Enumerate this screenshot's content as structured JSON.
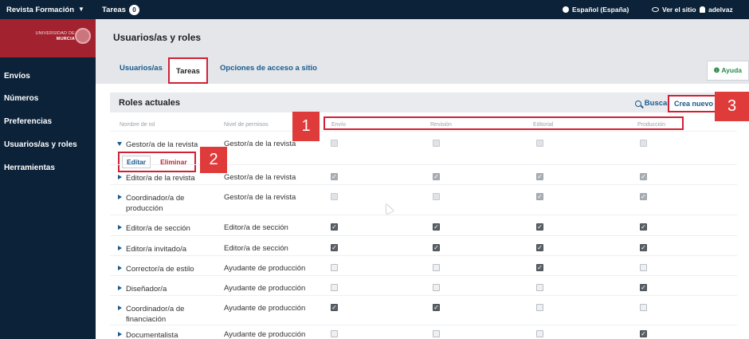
{
  "topbar": {
    "site_name": "Revista Formación",
    "tasks_label": "Tareas",
    "tasks_count": "0",
    "language": "Español (España)",
    "view_site": "Ver el sitio",
    "user": "adelvaz"
  },
  "logo": {
    "line1": "UNIVERSIDAD DE",
    "line2": "MURCIA"
  },
  "sidebar": {
    "items": [
      {
        "label": "Envíos"
      },
      {
        "label": "Números"
      },
      {
        "label": "Preferencias"
      },
      {
        "label": "Usuarios/as y roles"
      },
      {
        "label": "Herramientas"
      }
    ]
  },
  "header": {
    "title": "Usuarios/as y roles",
    "tabs": [
      {
        "label": "Usuarios/as"
      },
      {
        "label": "Tareas"
      },
      {
        "label": "Opciones de acceso a sitio"
      }
    ],
    "help": "Ayuda"
  },
  "panel": {
    "title": "Roles actuales",
    "search": "Buscar",
    "create": "Crea nuevo rol",
    "columns": {
      "name": "Nombre de rol",
      "level": "Nivel de permisos",
      "envio": "Envío",
      "revision": "Revisión",
      "editorial": "Editorial",
      "produccion": "Producción"
    },
    "edit": "Editar",
    "delete": "Eliminar",
    "rows": [
      {
        "name": "Gestor/a de la revista",
        "level": "Gestor/a de la revista",
        "stages": [
          false,
          false,
          false,
          false
        ],
        "dim": true,
        "expanded": true
      },
      {
        "name": "Editor/a de la revista",
        "level": "Gestor/a de la revista",
        "stages": [
          true,
          true,
          true,
          true
        ],
        "dim": true
      },
      {
        "name": "Coordinador/a de producción",
        "level": "Gestor/a de la revista",
        "stages": [
          false,
          false,
          true,
          true
        ],
        "dim": true
      },
      {
        "name": "Editor/a de sección",
        "level": "Editor/a de sección",
        "stages": [
          true,
          true,
          true,
          true
        ],
        "dim": false
      },
      {
        "name": "Editor/a invitado/a",
        "level": "Editor/a de sección",
        "stages": [
          true,
          true,
          true,
          true
        ],
        "dim": false
      },
      {
        "name": "Corrector/a de estilo",
        "level": "Ayudante de producción",
        "stages": [
          false,
          false,
          true,
          false
        ],
        "dim": false
      },
      {
        "name": "Diseñador/a",
        "level": "Ayudante de producción",
        "stages": [
          false,
          false,
          false,
          true
        ],
        "dim": false
      },
      {
        "name": "Coordinador/a de financiación",
        "level": "Ayudante de producción",
        "stages": [
          true,
          true,
          false,
          false
        ],
        "dim": false
      },
      {
        "name": "Documentalista",
        "level": "Ayudante de producción",
        "stages": [
          false,
          false,
          false,
          true
        ],
        "dim": false
      }
    ]
  },
  "annotations": [
    "1",
    "2",
    "3"
  ],
  "colors": {
    "nav": "#0b2239",
    "brand": "#a2232f",
    "link": "#1a5a8c",
    "highlight": "#d31f35"
  }
}
